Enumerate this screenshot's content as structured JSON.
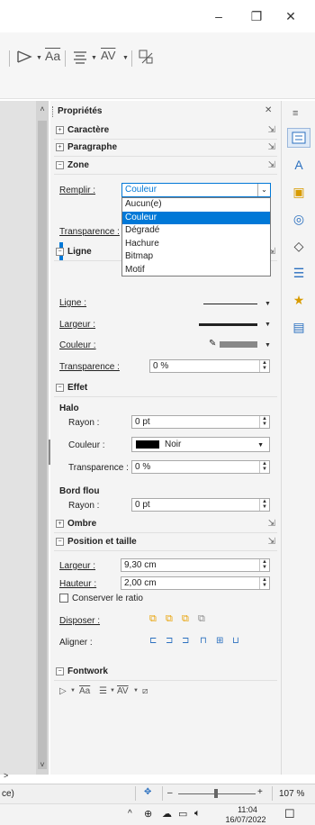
{
  "window": {
    "minimize": "–",
    "restore": "❐",
    "close": "✕"
  },
  "toolbar": {
    "font_label": "Aa",
    "spacing_label": "AV"
  },
  "sidebar": {
    "title": "Propriétés",
    "close": "✕",
    "menu": "≡",
    "sections": {
      "caractere": "Caractère",
      "paragraphe": "Paragraphe",
      "zone": "Zone",
      "ligne": "Ligne",
      "effet": "Effet",
      "ombre": "Ombre",
      "position": "Position et taille",
      "fontwork": "Fontwork"
    },
    "zone": {
      "remplir_label": "Remplir :",
      "remplir_value": "Couleur",
      "options": [
        "Aucun(e)",
        "Couleur",
        "Dégradé",
        "Hachure",
        "Bitmap",
        "Motif"
      ],
      "selected_index": 1,
      "transparence_label": "Transparence :"
    },
    "ligne": {
      "ligne_label": "Ligne :",
      "largeur_label": "Largeur :",
      "couleur_label": "Couleur :",
      "transparence_label": "Transparence :",
      "transparence_value": "0 %"
    },
    "effet": {
      "halo_title": "Halo",
      "rayon_label": "Rayon :",
      "rayon_value": "0 pt",
      "couleur_label": "Couleur :",
      "couleur_value": "Noir",
      "transparence_label": "Transparence :",
      "transparence_value": "0 %",
      "bord_title": "Bord flou",
      "bord_rayon_label": "Rayon :",
      "bord_rayon_value": "0 pt"
    },
    "position": {
      "largeur_label": "Largeur :",
      "largeur_value": "9,30 cm",
      "hauteur_label": "Hauteur :",
      "hauteur_value": "2,00 cm",
      "ratio_label": "Conserver le ratio",
      "disposer_label": "Disposer :",
      "aligner_label": "Aligner :"
    }
  },
  "status": {
    "left_text": "ce)",
    "zoom": "107 %",
    "minus": "–",
    "plus": "+"
  },
  "taskbar": {
    "time": "11:04",
    "date": "16/07/2022"
  },
  "colors": {
    "accent": "#0078d7",
    "swatch": "#000000"
  }
}
